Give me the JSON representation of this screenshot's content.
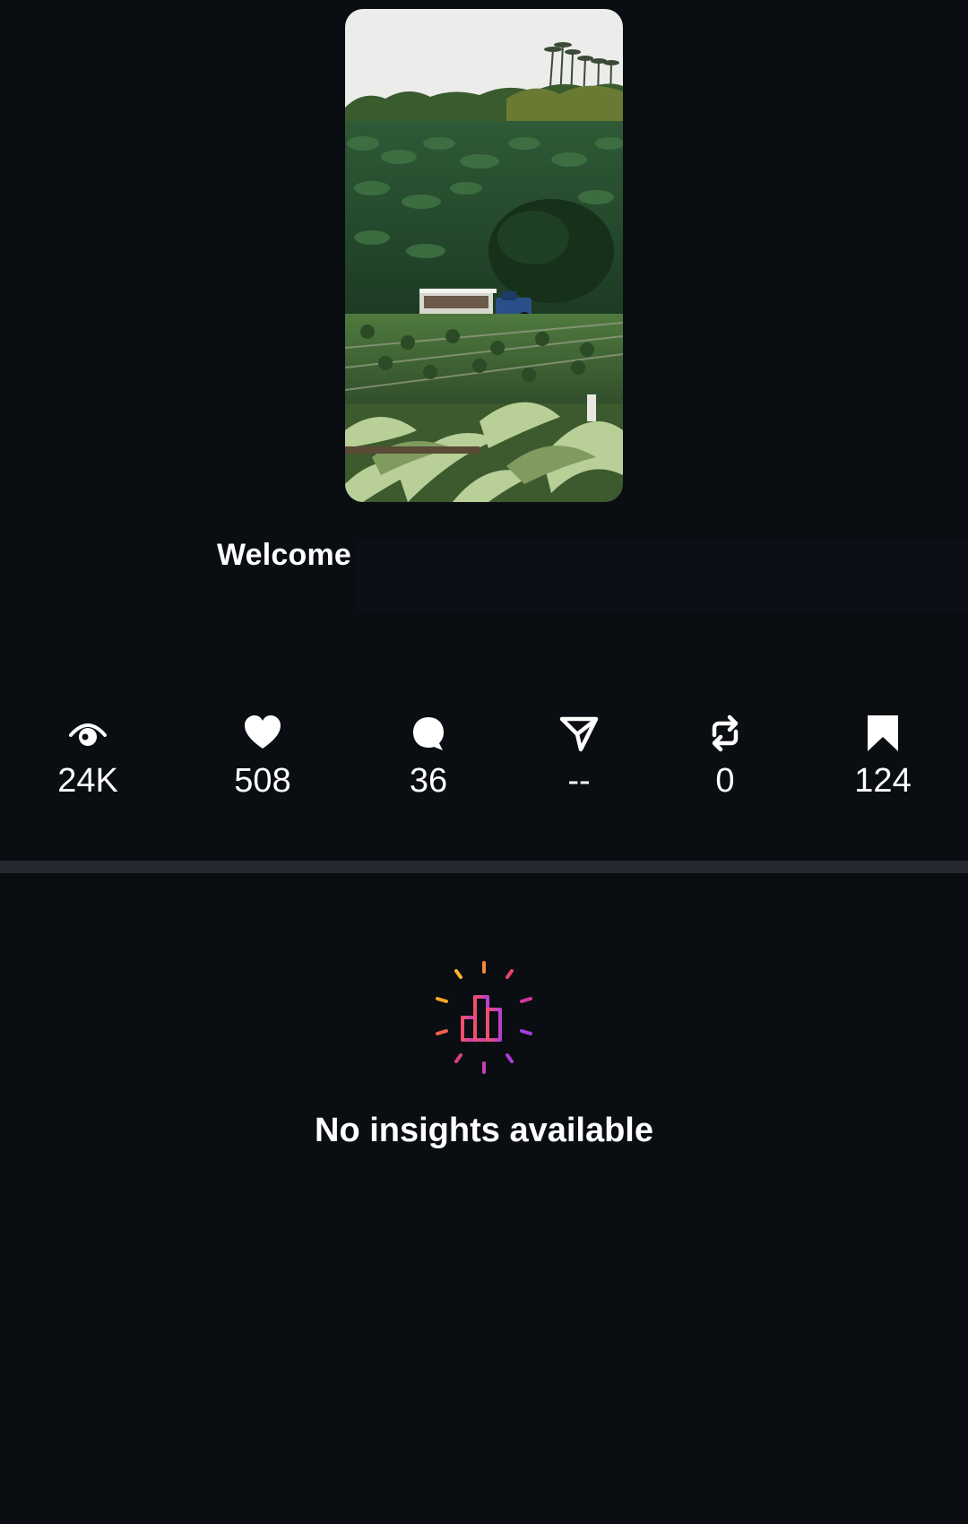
{
  "post": {
    "thumbnail_icon": "farm-landscape-photo",
    "caption": "Welcome"
  },
  "stats": [
    {
      "icon": "eye-icon",
      "value": "24K"
    },
    {
      "icon": "heart-icon",
      "value": "508"
    },
    {
      "icon": "comment-icon",
      "value": "36"
    },
    {
      "icon": "share-icon",
      "value": "--"
    },
    {
      "icon": "repost-icon",
      "value": "0"
    },
    {
      "icon": "bookmark-icon",
      "value": "124"
    }
  ],
  "insights": {
    "empty_icon": "chart-sparkle-icon",
    "empty_title": "No insights available"
  },
  "colors": {
    "background": "#0a0d12",
    "divider": "#25292f",
    "gradient_start": "#f5a623",
    "gradient_mid": "#e8336b",
    "gradient_end": "#9b3bf0"
  }
}
